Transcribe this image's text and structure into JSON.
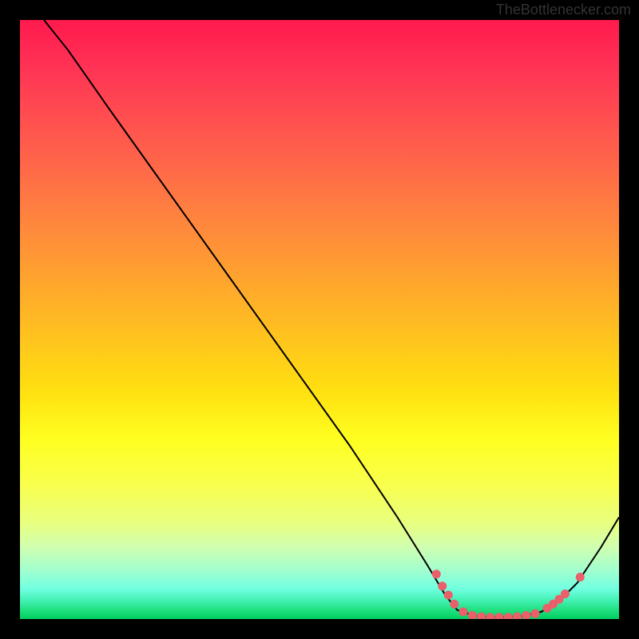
{
  "attribution": "TheBottlenecker.com",
  "chart_data": {
    "type": "line",
    "title": "",
    "xlabel": "",
    "ylabel": "",
    "x_range": [
      0,
      100
    ],
    "y_range": [
      0,
      100
    ],
    "curve_points": [
      {
        "x": 4,
        "y": 100
      },
      {
        "x": 8,
        "y": 95
      },
      {
        "x": 15,
        "y": 85
      },
      {
        "x": 25,
        "y": 71
      },
      {
        "x": 35,
        "y": 57
      },
      {
        "x": 45,
        "y": 43
      },
      {
        "x": 55,
        "y": 29
      },
      {
        "x": 63,
        "y": 17
      },
      {
        "x": 68,
        "y": 9
      },
      {
        "x": 71,
        "y": 4
      },
      {
        "x": 73,
        "y": 1.5
      },
      {
        "x": 76,
        "y": 0.5
      },
      {
        "x": 80,
        "y": 0.3
      },
      {
        "x": 84,
        "y": 0.5
      },
      {
        "x": 87,
        "y": 1.2
      },
      {
        "x": 90,
        "y": 3
      },
      {
        "x": 93,
        "y": 6
      },
      {
        "x": 97,
        "y": 12
      },
      {
        "x": 100,
        "y": 17
      }
    ],
    "marker_points": [
      {
        "x": 69.5,
        "y": 7.5
      },
      {
        "x": 70.5,
        "y": 5.5
      },
      {
        "x": 71.5,
        "y": 4
      },
      {
        "x": 72.5,
        "y": 2.5
      },
      {
        "x": 74,
        "y": 1.2
      },
      {
        "x": 75.5,
        "y": 0.6
      },
      {
        "x": 77,
        "y": 0.4
      },
      {
        "x": 78.5,
        "y": 0.3
      },
      {
        "x": 80,
        "y": 0.3
      },
      {
        "x": 81.5,
        "y": 0.3
      },
      {
        "x": 83,
        "y": 0.4
      },
      {
        "x": 84.5,
        "y": 0.6
      },
      {
        "x": 86,
        "y": 0.9
      },
      {
        "x": 88,
        "y": 1.8
      },
      {
        "x": 89,
        "y": 2.5
      },
      {
        "x": 90,
        "y": 3.3
      },
      {
        "x": 91,
        "y": 4.2
      },
      {
        "x": 93.5,
        "y": 7
      }
    ],
    "marker_color": "#e95f6a",
    "curve_color": "#000000"
  }
}
